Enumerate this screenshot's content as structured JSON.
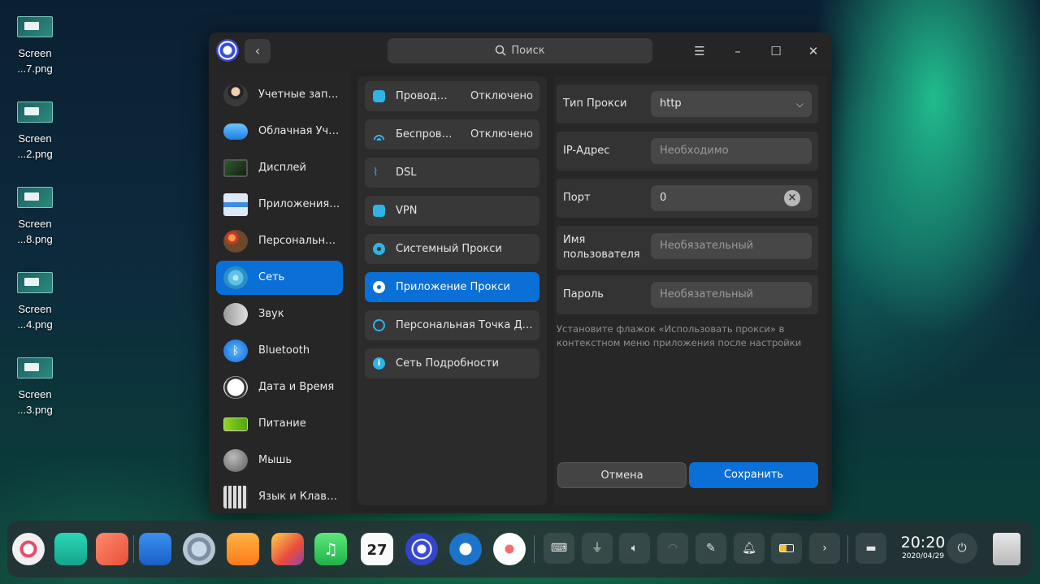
{
  "desktop": {
    "icons": [
      {
        "line1": "Screen",
        "line2": "...7.png"
      },
      {
        "line1": "Screen",
        "line2": "...2.png"
      },
      {
        "line1": "Screen",
        "line2": "...8.png"
      },
      {
        "line1": "Screen",
        "line2": "...4.png"
      },
      {
        "line1": "Screen",
        "line2": "...3.png"
      }
    ]
  },
  "window": {
    "search_placeholder": "Поиск",
    "sidebar": [
      {
        "label": "Учетные записи",
        "icon": "accounts-icon"
      },
      {
        "label": "Облачная Учетная запись",
        "icon": "cloud-icon"
      },
      {
        "label": "Дисплей",
        "icon": "display-icon"
      },
      {
        "label": "Приложения по умолчанию",
        "icon": "default-apps-icon"
      },
      {
        "label": "Персональные настройки",
        "icon": "personalization-icon"
      },
      {
        "label": "Сеть",
        "icon": "network-icon",
        "active": true
      },
      {
        "label": "Звук",
        "icon": "sound-icon"
      },
      {
        "label": "Bluetooth",
        "icon": "bluetooth-icon"
      },
      {
        "label": "Дата и Время",
        "icon": "clock-icon"
      },
      {
        "label": "Питание",
        "icon": "battery-icon"
      },
      {
        "label": "Мышь",
        "icon": "mouse-icon"
      },
      {
        "label": "Язык и Клавиатура",
        "icon": "keyboard-icon"
      }
    ],
    "network_menu": [
      {
        "label": "Проводная сеть",
        "status": "Отключено",
        "icon": "wired-icon"
      },
      {
        "label": "Беспроводная сеть",
        "status": "Отключено",
        "icon": "wifi-icon"
      },
      {
        "label": "DSL",
        "status": "",
        "icon": "dsl-icon"
      },
      {
        "label": "VPN",
        "status": "",
        "icon": "vpn-icon"
      },
      {
        "label": "Системный Прокси",
        "status": "",
        "icon": "system-proxy-icon"
      },
      {
        "label": "Приложение Прокси",
        "status": "",
        "icon": "app-proxy-icon",
        "active": true
      },
      {
        "label": "Персональная Точка Доступа",
        "status": "",
        "icon": "hotspot-icon"
      },
      {
        "label": "Сеть Подробности",
        "status": "",
        "icon": "info-icon"
      }
    ],
    "proxy_form": {
      "type_label": "Тип Прокси",
      "type_value": "http",
      "ip_label": "IP-Адрес",
      "ip_placeholder": "Необходимо",
      "port_label": "Порт",
      "port_value": "0",
      "user_label_1": "Имя",
      "user_label_2": "пользователя",
      "user_placeholder": "Необязательный",
      "password_label": "Пароль",
      "password_placeholder": "Необязательный",
      "hint": "Установите флажок «Использовать прокси» в контекстном меню приложения после настройки",
      "cancel": "Отмена",
      "save": "Сохранить"
    }
  },
  "dock": {
    "time": "20:20",
    "date": "2020/04/29",
    "calendar_day": "27",
    "accent": "#0a6fd6"
  }
}
